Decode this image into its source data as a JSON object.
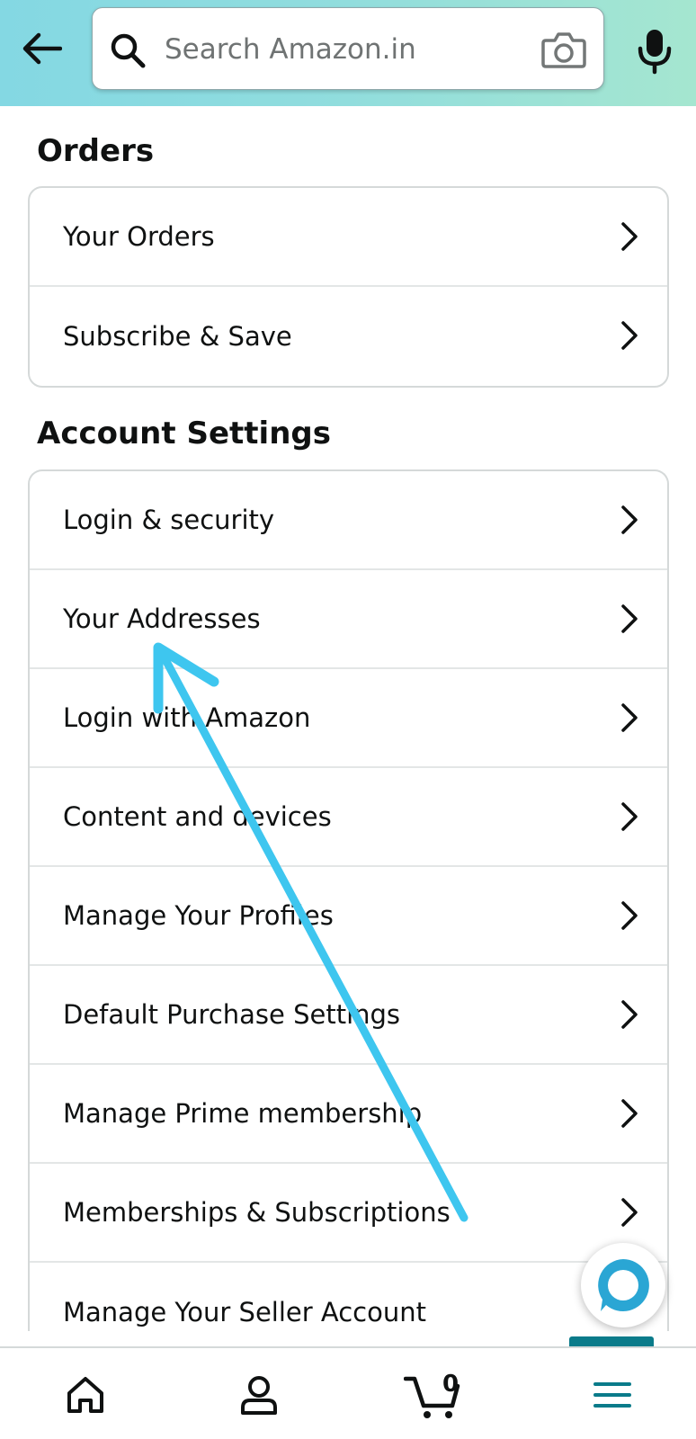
{
  "search": {
    "placeholder": "Search Amazon.in"
  },
  "sections": {
    "orders": {
      "title": "Orders",
      "items": [
        {
          "label": "Your Orders"
        },
        {
          "label": "Subscribe & Save"
        }
      ]
    },
    "account_settings": {
      "title": "Account Settings",
      "items": [
        {
          "label": "Login & security"
        },
        {
          "label": "Your Addresses"
        },
        {
          "label": "Login with Amazon"
        },
        {
          "label": "Content and devices"
        },
        {
          "label": "Manage Your Profiles"
        },
        {
          "label": "Default Purchase Settings"
        },
        {
          "label": "Manage Prime membership"
        },
        {
          "label": "Memberships & Subscriptions"
        },
        {
          "label": "Manage Your Seller Account"
        }
      ]
    }
  },
  "bottom_nav": {
    "cart_count": "0",
    "items": [
      {
        "icon": "home-icon"
      },
      {
        "icon": "user-icon"
      },
      {
        "icon": "cart-icon"
      },
      {
        "icon": "menu-icon",
        "active": true
      }
    ]
  },
  "colors": {
    "header_gradient_start": "#84d8e3",
    "header_gradient_end": "#a5e6d0",
    "active_nav": "#0a7b8a",
    "annotation_arrow": "#3ec6ef",
    "alexa": "#2aa6d4"
  },
  "icons": {
    "back": "arrow-left-icon",
    "search": "search-icon",
    "camera": "camera-icon",
    "mic": "microphone-icon",
    "chevron": "chevron-right-icon",
    "alexa": "alexa-icon"
  }
}
